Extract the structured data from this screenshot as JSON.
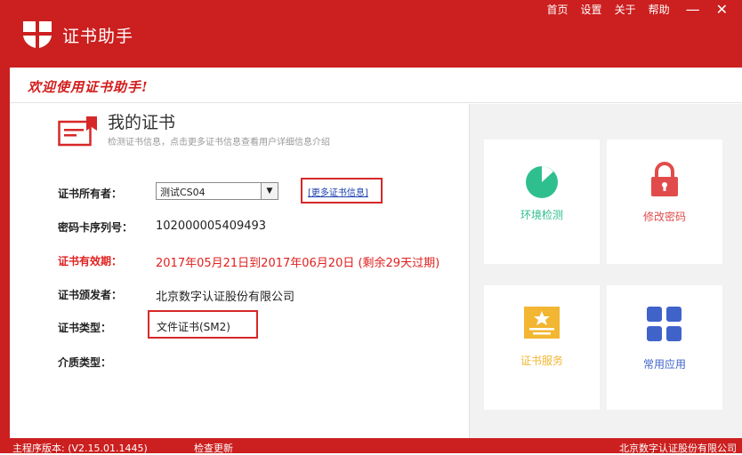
{
  "app": {
    "title": "证书助手"
  },
  "nav": {
    "items": [
      "首页",
      "设置",
      "关于",
      "帮助"
    ],
    "minimize": "—",
    "close": "✕"
  },
  "welcome": "欢迎使用证书助手!",
  "my_cert": {
    "title": "我的证书",
    "subtitle": "检测证书信息，点击更多证书信息查看用户详细信息介绍"
  },
  "fields": {
    "owner": {
      "label": "证书所有者：",
      "value": "测试CS04",
      "more_link": "[更多证书信息]"
    },
    "serial": {
      "label": "密码卡序列号：",
      "value": "102000005409493"
    },
    "validity": {
      "label": "证书有效期：",
      "value": "2017年05月21日到2017年06月20日 (剩余29天过期)"
    },
    "issuer": {
      "label": "证书颁发者：",
      "value": "北京数字认证股份有限公司"
    },
    "type": {
      "label": "证书类型：",
      "value": "文件证书(SM2)"
    },
    "medium": {
      "label": "介质类型：",
      "value": ""
    }
  },
  "tiles": {
    "env_check": {
      "label": "环境检测",
      "color": "#2fbf8f"
    },
    "change_pwd": {
      "label": "修改密码",
      "color": "#e24b4b"
    },
    "cert_service": {
      "label": "证书服务",
      "color": "#f2b632"
    },
    "common_apps": {
      "label": "常用应用",
      "color": "#3f63c9"
    }
  },
  "status": {
    "version": "主程序版本: (V2.15.01.1445)",
    "check_update": "检查更新",
    "company": "北京数字认证股份有限公司"
  },
  "colors": {
    "brand_red": "#cc1f1f",
    "highlight_red": "#d62828",
    "link_blue": "#1b3faf"
  }
}
